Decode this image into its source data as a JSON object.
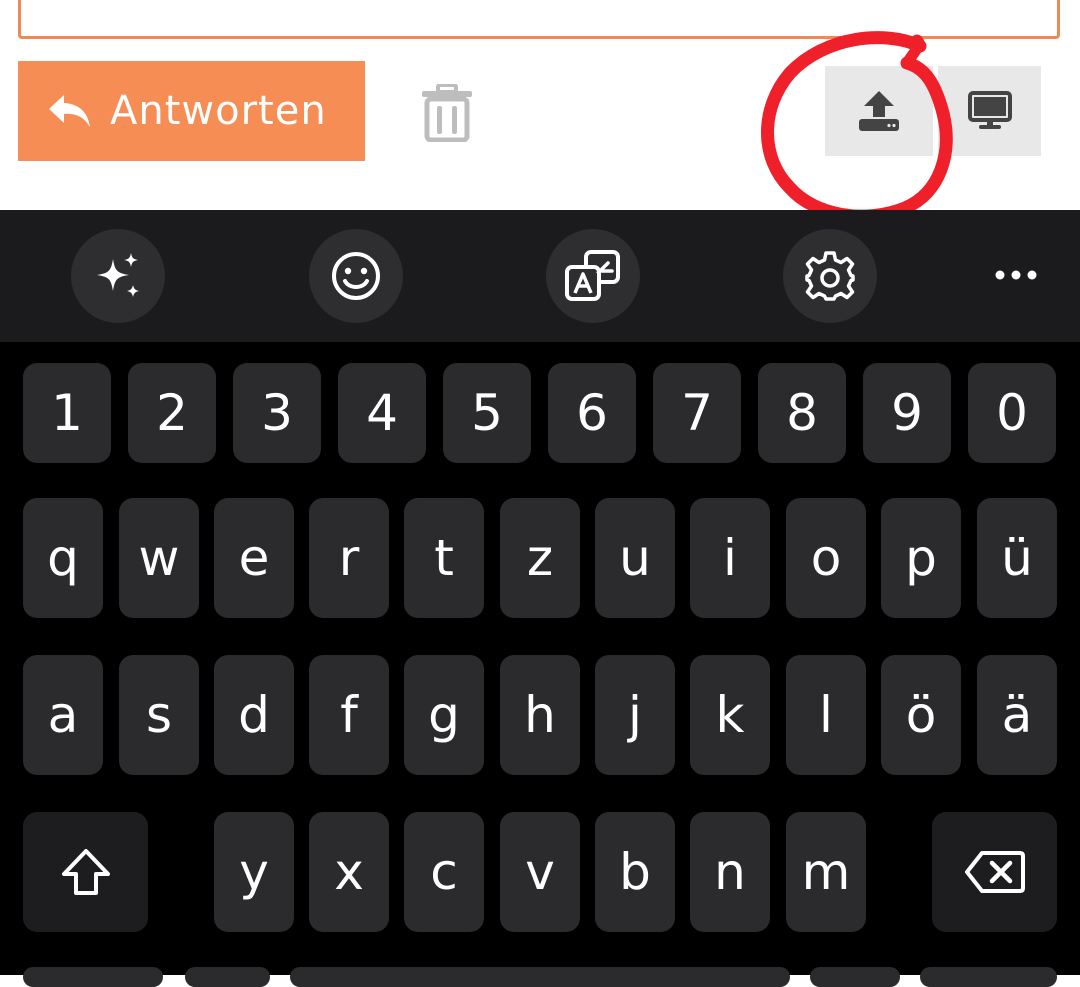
{
  "web": {
    "reply_label": "Antworten",
    "icons": {
      "reply": "reply-arrow-icon",
      "delete": "trash-icon",
      "upload": "upload-icon",
      "screen": "monitor-icon"
    },
    "colors": {
      "accent": "#f68d54",
      "annotation": "#f0202a",
      "icon_gray": "#bdbdbd"
    }
  },
  "keyboard": {
    "toolbar": [
      "sparkle-ai-icon",
      "emoji-icon",
      "translate-icon",
      "settings-gear-icon",
      "more-dots-icon"
    ],
    "number_row": [
      "1",
      "2",
      "3",
      "4",
      "5",
      "6",
      "7",
      "8",
      "9",
      "0"
    ],
    "row1": [
      "q",
      "w",
      "e",
      "r",
      "t",
      "z",
      "u",
      "i",
      "o",
      "p",
      "ü"
    ],
    "row2": [
      "a",
      "s",
      "d",
      "f",
      "g",
      "h",
      "j",
      "k",
      "l",
      "ö",
      "ä"
    ],
    "row3": [
      "y",
      "x",
      "c",
      "v",
      "b",
      "n",
      "m"
    ],
    "special": {
      "shift": "shift-icon",
      "backspace": "backspace-icon"
    },
    "colors": {
      "key": "#2b2b2e",
      "toolbar": "#1b1b1d",
      "background": "#000000"
    }
  }
}
